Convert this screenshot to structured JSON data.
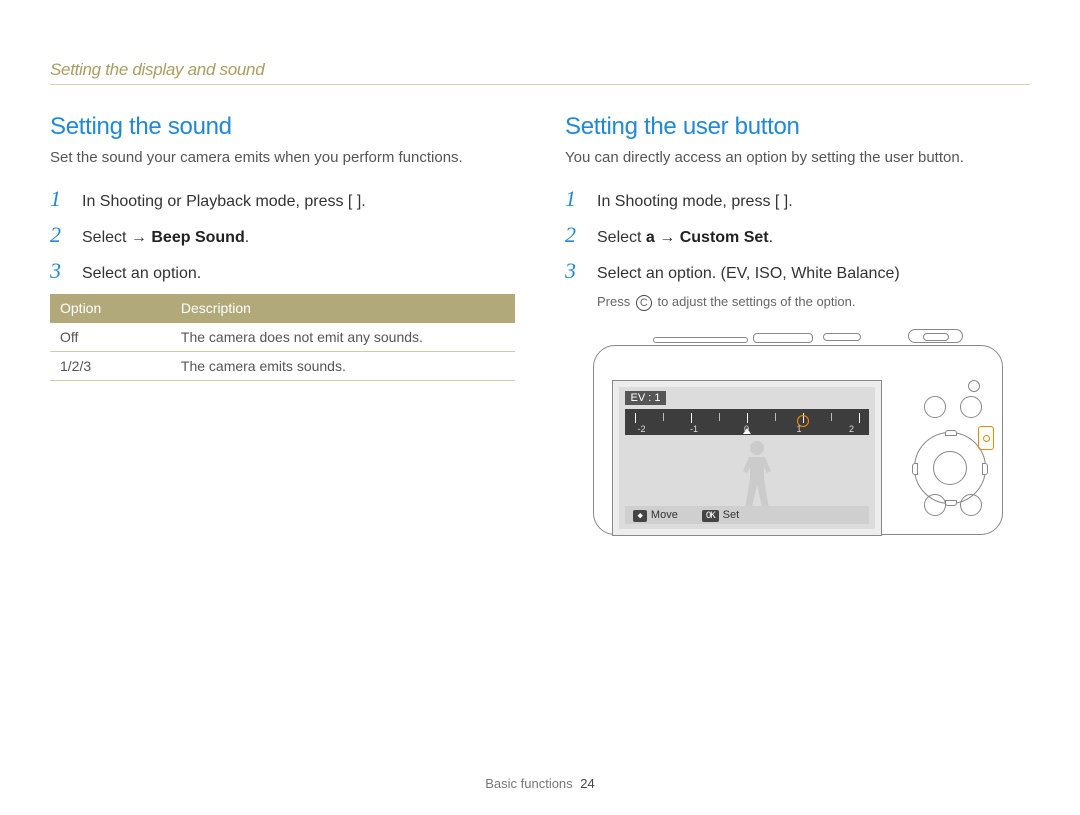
{
  "breadcrumb": "Setting the display and sound",
  "left": {
    "heading": "Setting the sound",
    "intro": "Set the sound your camera emits when you perform functions.",
    "steps": {
      "s1": "In Shooting or Playback mode, press [          ].",
      "s2_pre": "Select   ",
      "s2_arrow": "→",
      "s2_bold": " Beep Sound",
      "s2_post": ".",
      "s3": "Select an option."
    },
    "table": {
      "h1": "Option",
      "h2": "Description",
      "r1c1": "Off",
      "r1c2": "The camera does not emit any sounds.",
      "r2c1": "1/2/3",
      "r2c2": "The camera emits sounds."
    }
  },
  "right": {
    "heading": "Setting the user button",
    "intro": "You can directly access an option by setting the user button.",
    "steps": {
      "s1": "In Shooting mode, press [          ].",
      "s2_pre": "Select ",
      "s2_a": "a",
      "s2_arrow": "   → ",
      "s2_bold": "Custom Set",
      "s2_post": ".",
      "s3": "Select an option. (EV, ISO, White Balance)"
    },
    "sub_pre": "Press ",
    "sub_c": "C",
    "sub_post": " to adjust the settings of the option."
  },
  "camera_screen": {
    "ev_label": "EV : 1",
    "scale": {
      "neg2": "-2",
      "neg1": "-1",
      "zero": "0",
      "pos1": "1",
      "pos2": "2"
    },
    "hint_move_chip": "◆",
    "hint_move": "Move",
    "hint_set_chip": "OK",
    "hint_set": "Set"
  },
  "footer": {
    "section": "Basic functions",
    "page": "24"
  },
  "nums": {
    "n1": "1",
    "n2": "2",
    "n3": "3"
  }
}
